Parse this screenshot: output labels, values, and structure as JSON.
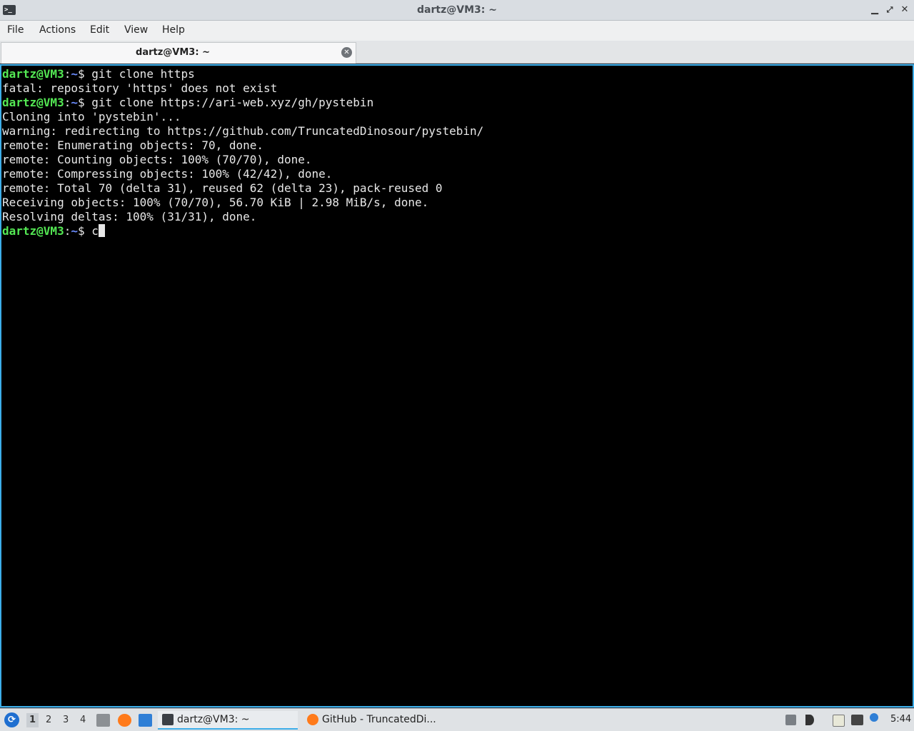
{
  "window": {
    "title": "dartz@VM3: ~",
    "icon": "terminal-icon",
    "controls": {
      "minimize": "▁",
      "maximize": "⤢",
      "close": "✕"
    }
  },
  "menubar": {
    "items": [
      "File",
      "Actions",
      "Edit",
      "View",
      "Help"
    ]
  },
  "tabs": [
    {
      "label": "dartz@VM3: ~",
      "active": true,
      "close_icon": "close-circle-icon"
    }
  ],
  "terminal": {
    "prompt": {
      "user_host": "dartz@VM3",
      "separator": ":",
      "path": "~",
      "symbol": "$ "
    },
    "colors": {
      "user": "#54e854",
      "path": "#6b8cff",
      "text": "#e8e8e8",
      "background": "#000000",
      "border": "#3daee9"
    },
    "lines": [
      {
        "type": "prompt",
        "command": "git clone https"
      },
      {
        "type": "output",
        "text": "fatal: repository 'https' does not exist"
      },
      {
        "type": "prompt",
        "command": "git clone https://ari-web.xyz/gh/pystebin"
      },
      {
        "type": "output",
        "text": "Cloning into 'pystebin'..."
      },
      {
        "type": "output",
        "text": "warning: redirecting to https://github.com/TruncatedDinosour/pystebin/"
      },
      {
        "type": "output",
        "text": "remote: Enumerating objects: 70, done."
      },
      {
        "type": "output",
        "text": "remote: Counting objects: 100% (70/70), done."
      },
      {
        "type": "output",
        "text": "remote: Compressing objects: 100% (42/42), done."
      },
      {
        "type": "output",
        "text": "remote: Total 70 (delta 31), reused 62 (delta 23), pack-reused 0"
      },
      {
        "type": "output",
        "text": "Receiving objects: 100% (70/70), 56.70 KiB | 2.98 MiB/s, done."
      },
      {
        "type": "output",
        "text": "Resolving deltas: 100% (31/31), done."
      },
      {
        "type": "prompt",
        "command": "c",
        "cursor": true
      }
    ]
  },
  "taskbar": {
    "start_icon": "lubuntu-start-icon",
    "workspaces": [
      {
        "label": "1",
        "active": true
      },
      {
        "label": "2",
        "active": false
      },
      {
        "label": "3",
        "active": false
      },
      {
        "label": "4",
        "active": false
      }
    ],
    "launchers": [
      "file-manager-icon",
      "firefox-icon",
      "show-desktop-icon"
    ],
    "tasks": [
      {
        "label": "dartz@VM3: ~",
        "icon": "terminal-icon",
        "active": true
      },
      {
        "label": "GitHub - TruncatedDi...",
        "icon": "firefox-icon",
        "active": false
      }
    ],
    "tray": [
      "removable-drive-icon",
      "volume-icon",
      "clipboard-icon",
      "network-icon",
      "update-notifier-icon"
    ],
    "clock": "5:44"
  }
}
